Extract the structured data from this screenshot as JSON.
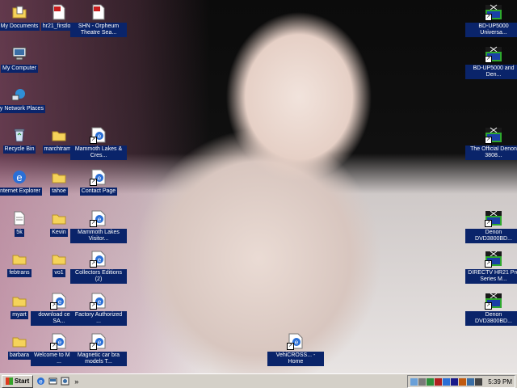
{
  "desktop_icons": [
    {
      "label": "My Documents",
      "icon": "folder-documents-icon"
    },
    {
      "label": "hr21_firstlo...",
      "icon": "pdf-icon"
    },
    {
      "label": "SHN - Orpheum Theatre Sea...",
      "icon": "pdf-icon"
    },
    {
      "label": "My Computer",
      "icon": "computer-icon"
    },
    {
      "label": "My Network Places",
      "icon": "network-icon"
    },
    {
      "label": "Recycle Bin",
      "icon": "recycle-bin-icon"
    },
    {
      "label": "marchtrams",
      "icon": "folder-icon"
    },
    {
      "label": "Mammoth Lakes & Cres...",
      "icon": "ie-shortcut-icon"
    },
    {
      "label": "Internet Explorer",
      "icon": "ie-icon"
    },
    {
      "label": "tahoe",
      "icon": "folder-icon"
    },
    {
      "label": "Contact Page",
      "icon": "ie-shortcut-icon"
    },
    {
      "label": "5k",
      "icon": "document-icon"
    },
    {
      "label": "Kevin",
      "icon": "folder-icon"
    },
    {
      "label": "Mammoth Lakes Visitor...",
      "icon": "ie-shortcut-icon"
    },
    {
      "label": "febtrans",
      "icon": "folder-icon"
    },
    {
      "label": "vo1",
      "icon": "folder-icon"
    },
    {
      "label": "Collectors Editions (2)",
      "icon": "ie-shortcut-icon"
    },
    {
      "label": "myart",
      "icon": "folder-icon"
    },
    {
      "label": "download center SA...",
      "icon": "ie-shortcut-icon"
    },
    {
      "label": "Factory Authorized ...",
      "icon": "ie-shortcut-icon"
    },
    {
      "label": "barbara",
      "icon": "folder-icon"
    },
    {
      "label": "Welcome to Minaret ...",
      "icon": "ie-shortcut-icon"
    },
    {
      "label": "Magnetic car bra models T...",
      "icon": "ie-shortcut-icon"
    },
    {
      "label": "VehiCROSS... - Home",
      "icon": "ie-shortcut-icon"
    },
    {
      "label": "BD-UP5000 Universa...",
      "icon": "x-shortcut-icon"
    },
    {
      "label": "BD-UP5000 and Den...",
      "icon": "x-shortcut-icon"
    },
    {
      "label": "The Official Denon 3808...",
      "icon": "x-shortcut-icon"
    },
    {
      "label": "Denon DVD3800BD...",
      "icon": "x-shortcut-icon"
    },
    {
      "label": "DIRECTV HR21 Pro Series M...",
      "icon": "x-shortcut-icon"
    },
    {
      "label": "Denon DVD3800BD...",
      "icon": "x-shortcut-icon"
    }
  ],
  "taskbar": {
    "start_label": "Start",
    "quick_launch": [
      "ie-icon",
      "desktop-icon",
      "media-icon"
    ],
    "overflow_label": "»",
    "clock": "5:39 PM"
  },
  "colors": {
    "selection": "#0a246a",
    "taskbar": "#d4d0c8"
  }
}
